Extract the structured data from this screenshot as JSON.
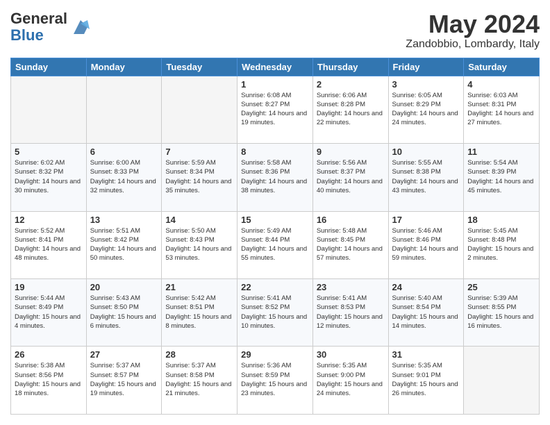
{
  "header": {
    "logo_line1": "General",
    "logo_line2": "Blue",
    "month": "May 2024",
    "location": "Zandobbio, Lombardy, Italy"
  },
  "days_of_week": [
    "Sunday",
    "Monday",
    "Tuesday",
    "Wednesday",
    "Thursday",
    "Friday",
    "Saturday"
  ],
  "weeks": [
    [
      {
        "day": "",
        "empty": true
      },
      {
        "day": "",
        "empty": true
      },
      {
        "day": "",
        "empty": true
      },
      {
        "day": "1",
        "sunrise": "6:08 AM",
        "sunset": "8:27 PM",
        "daylight": "14 hours and 19 minutes."
      },
      {
        "day": "2",
        "sunrise": "6:06 AM",
        "sunset": "8:28 PM",
        "daylight": "14 hours and 22 minutes."
      },
      {
        "day": "3",
        "sunrise": "6:05 AM",
        "sunset": "8:29 PM",
        "daylight": "14 hours and 24 minutes."
      },
      {
        "day": "4",
        "sunrise": "6:03 AM",
        "sunset": "8:31 PM",
        "daylight": "14 hours and 27 minutes."
      }
    ],
    [
      {
        "day": "5",
        "sunrise": "6:02 AM",
        "sunset": "8:32 PM",
        "daylight": "14 hours and 30 minutes."
      },
      {
        "day": "6",
        "sunrise": "6:00 AM",
        "sunset": "8:33 PM",
        "daylight": "14 hours and 32 minutes."
      },
      {
        "day": "7",
        "sunrise": "5:59 AM",
        "sunset": "8:34 PM",
        "daylight": "14 hours and 35 minutes."
      },
      {
        "day": "8",
        "sunrise": "5:58 AM",
        "sunset": "8:36 PM",
        "daylight": "14 hours and 38 minutes."
      },
      {
        "day": "9",
        "sunrise": "5:56 AM",
        "sunset": "8:37 PM",
        "daylight": "14 hours and 40 minutes."
      },
      {
        "day": "10",
        "sunrise": "5:55 AM",
        "sunset": "8:38 PM",
        "daylight": "14 hours and 43 minutes."
      },
      {
        "day": "11",
        "sunrise": "5:54 AM",
        "sunset": "8:39 PM",
        "daylight": "14 hours and 45 minutes."
      }
    ],
    [
      {
        "day": "12",
        "sunrise": "5:52 AM",
        "sunset": "8:41 PM",
        "daylight": "14 hours and 48 minutes."
      },
      {
        "day": "13",
        "sunrise": "5:51 AM",
        "sunset": "8:42 PM",
        "daylight": "14 hours and 50 minutes."
      },
      {
        "day": "14",
        "sunrise": "5:50 AM",
        "sunset": "8:43 PM",
        "daylight": "14 hours and 53 minutes."
      },
      {
        "day": "15",
        "sunrise": "5:49 AM",
        "sunset": "8:44 PM",
        "daylight": "14 hours and 55 minutes."
      },
      {
        "day": "16",
        "sunrise": "5:48 AM",
        "sunset": "8:45 PM",
        "daylight": "14 hours and 57 minutes."
      },
      {
        "day": "17",
        "sunrise": "5:46 AM",
        "sunset": "8:46 PM",
        "daylight": "14 hours and 59 minutes."
      },
      {
        "day": "18",
        "sunrise": "5:45 AM",
        "sunset": "8:48 PM",
        "daylight": "15 hours and 2 minutes."
      }
    ],
    [
      {
        "day": "19",
        "sunrise": "5:44 AM",
        "sunset": "8:49 PM",
        "daylight": "15 hours and 4 minutes."
      },
      {
        "day": "20",
        "sunrise": "5:43 AM",
        "sunset": "8:50 PM",
        "daylight": "15 hours and 6 minutes."
      },
      {
        "day": "21",
        "sunrise": "5:42 AM",
        "sunset": "8:51 PM",
        "daylight": "15 hours and 8 minutes."
      },
      {
        "day": "22",
        "sunrise": "5:41 AM",
        "sunset": "8:52 PM",
        "daylight": "15 hours and 10 minutes."
      },
      {
        "day": "23",
        "sunrise": "5:41 AM",
        "sunset": "8:53 PM",
        "daylight": "15 hours and 12 minutes."
      },
      {
        "day": "24",
        "sunrise": "5:40 AM",
        "sunset": "8:54 PM",
        "daylight": "15 hours and 14 minutes."
      },
      {
        "day": "25",
        "sunrise": "5:39 AM",
        "sunset": "8:55 PM",
        "daylight": "15 hours and 16 minutes."
      }
    ],
    [
      {
        "day": "26",
        "sunrise": "5:38 AM",
        "sunset": "8:56 PM",
        "daylight": "15 hours and 18 minutes."
      },
      {
        "day": "27",
        "sunrise": "5:37 AM",
        "sunset": "8:57 PM",
        "daylight": "15 hours and 19 minutes."
      },
      {
        "day": "28",
        "sunrise": "5:37 AM",
        "sunset": "8:58 PM",
        "daylight": "15 hours and 21 minutes."
      },
      {
        "day": "29",
        "sunrise": "5:36 AM",
        "sunset": "8:59 PM",
        "daylight": "15 hours and 23 minutes."
      },
      {
        "day": "30",
        "sunrise": "5:35 AM",
        "sunset": "9:00 PM",
        "daylight": "15 hours and 24 minutes."
      },
      {
        "day": "31",
        "sunrise": "5:35 AM",
        "sunset": "9:01 PM",
        "daylight": "15 hours and 26 minutes."
      },
      {
        "day": "",
        "empty": true
      }
    ]
  ]
}
